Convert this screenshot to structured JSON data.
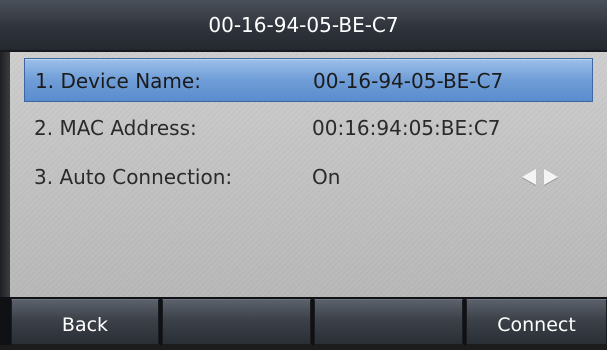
{
  "title_bar": {
    "title": "00-16-94-05-BE-C7"
  },
  "settings": {
    "rows": [
      {
        "label": "1. Device Name:",
        "value": "00-16-94-05-BE-C7",
        "selected": true
      },
      {
        "label": "2. MAC Address:",
        "value": "00:16:94:05:BE:C7",
        "selected": false
      },
      {
        "label": "3. Auto Connection:",
        "value": "On",
        "selected": false
      }
    ],
    "option_switch_icons": [
      "arrow-left-icon",
      "arrow-right-icon"
    ]
  },
  "softkeys": {
    "key1": "Back",
    "key2": "",
    "key3": "",
    "key4": "Connect"
  },
  "colors": {
    "title_bar": "#2f343c",
    "selection": "#6f9dd7",
    "softkey": "#3c4149",
    "screen_background": "#c4c4c4"
  }
}
